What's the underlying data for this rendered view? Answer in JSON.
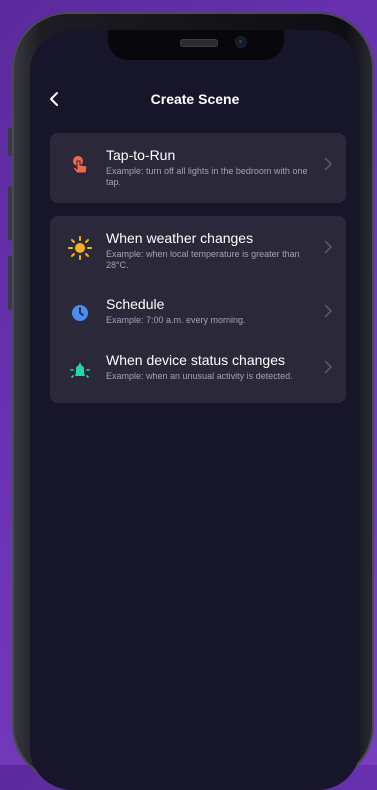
{
  "header": {
    "title": "Create Scene",
    "back_icon": "chevron-left-icon"
  },
  "cards": [
    {
      "items": [
        {
          "icon": "hand-tap-icon",
          "color": "#f06a4a",
          "title": "Tap-to-Run",
          "subtitle": "Example: turn off all lights in the bedroom with one tap."
        }
      ]
    },
    {
      "items": [
        {
          "icon": "sun-icon",
          "color": "#f5b21c",
          "title": "When weather changes",
          "subtitle": "Example: when local temperature is greater than 28°C."
        },
        {
          "icon": "clock-icon",
          "color": "#4a8ff0",
          "title": "Schedule",
          "subtitle": "Example: 7:00 a.m. every morning."
        },
        {
          "icon": "device-bell-icon",
          "color": "#23d7a8",
          "title": "When device status changes",
          "subtitle": "Example: when an unusual activity is detected."
        }
      ]
    }
  ],
  "colors": {
    "background": "#17152a",
    "card": "#2a2839",
    "accent_bg": "#6a32b4"
  }
}
